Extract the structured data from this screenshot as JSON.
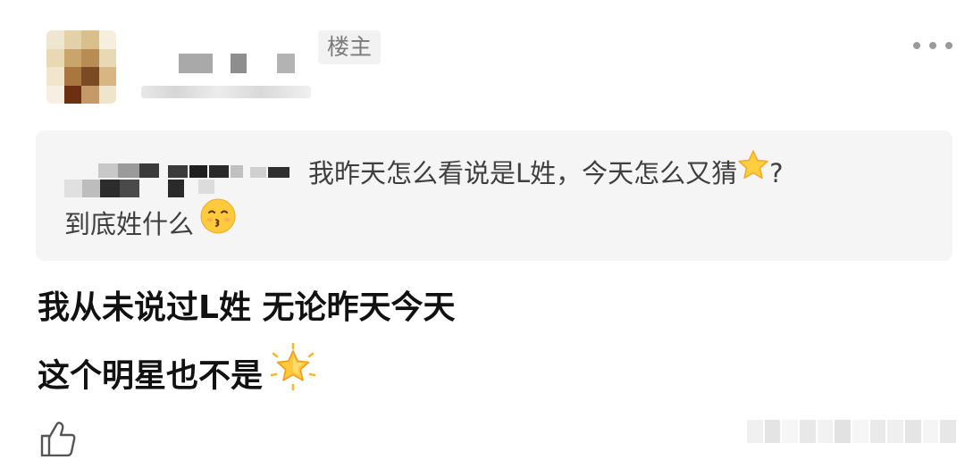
{
  "post": {
    "op_badge": "楼主"
  },
  "quote": {
    "line1": "我昨天怎么看说是L姓，今天怎么又猜",
    "line1_end": "?",
    "line2": "到底姓什么",
    "star_icon": "star-emoji-icon",
    "kiss_icon": "kissing-face-emoji-icon"
  },
  "comment": {
    "line1": "我从未说过L姓 无论昨天今天",
    "line2": "这个明星也不是",
    "sparkle_icon": "glowing-star-emoji-icon"
  },
  "actions": {
    "like_icon": "thumbs-up-icon",
    "more_icon": "more-dots-icon"
  },
  "colors": {
    "quote_background": "#f5f5f5",
    "badge_background": "#f2f2f2",
    "badge_text": "#7b7b7b",
    "body_text": "#111111",
    "quote_text": "#3f3f3f"
  }
}
